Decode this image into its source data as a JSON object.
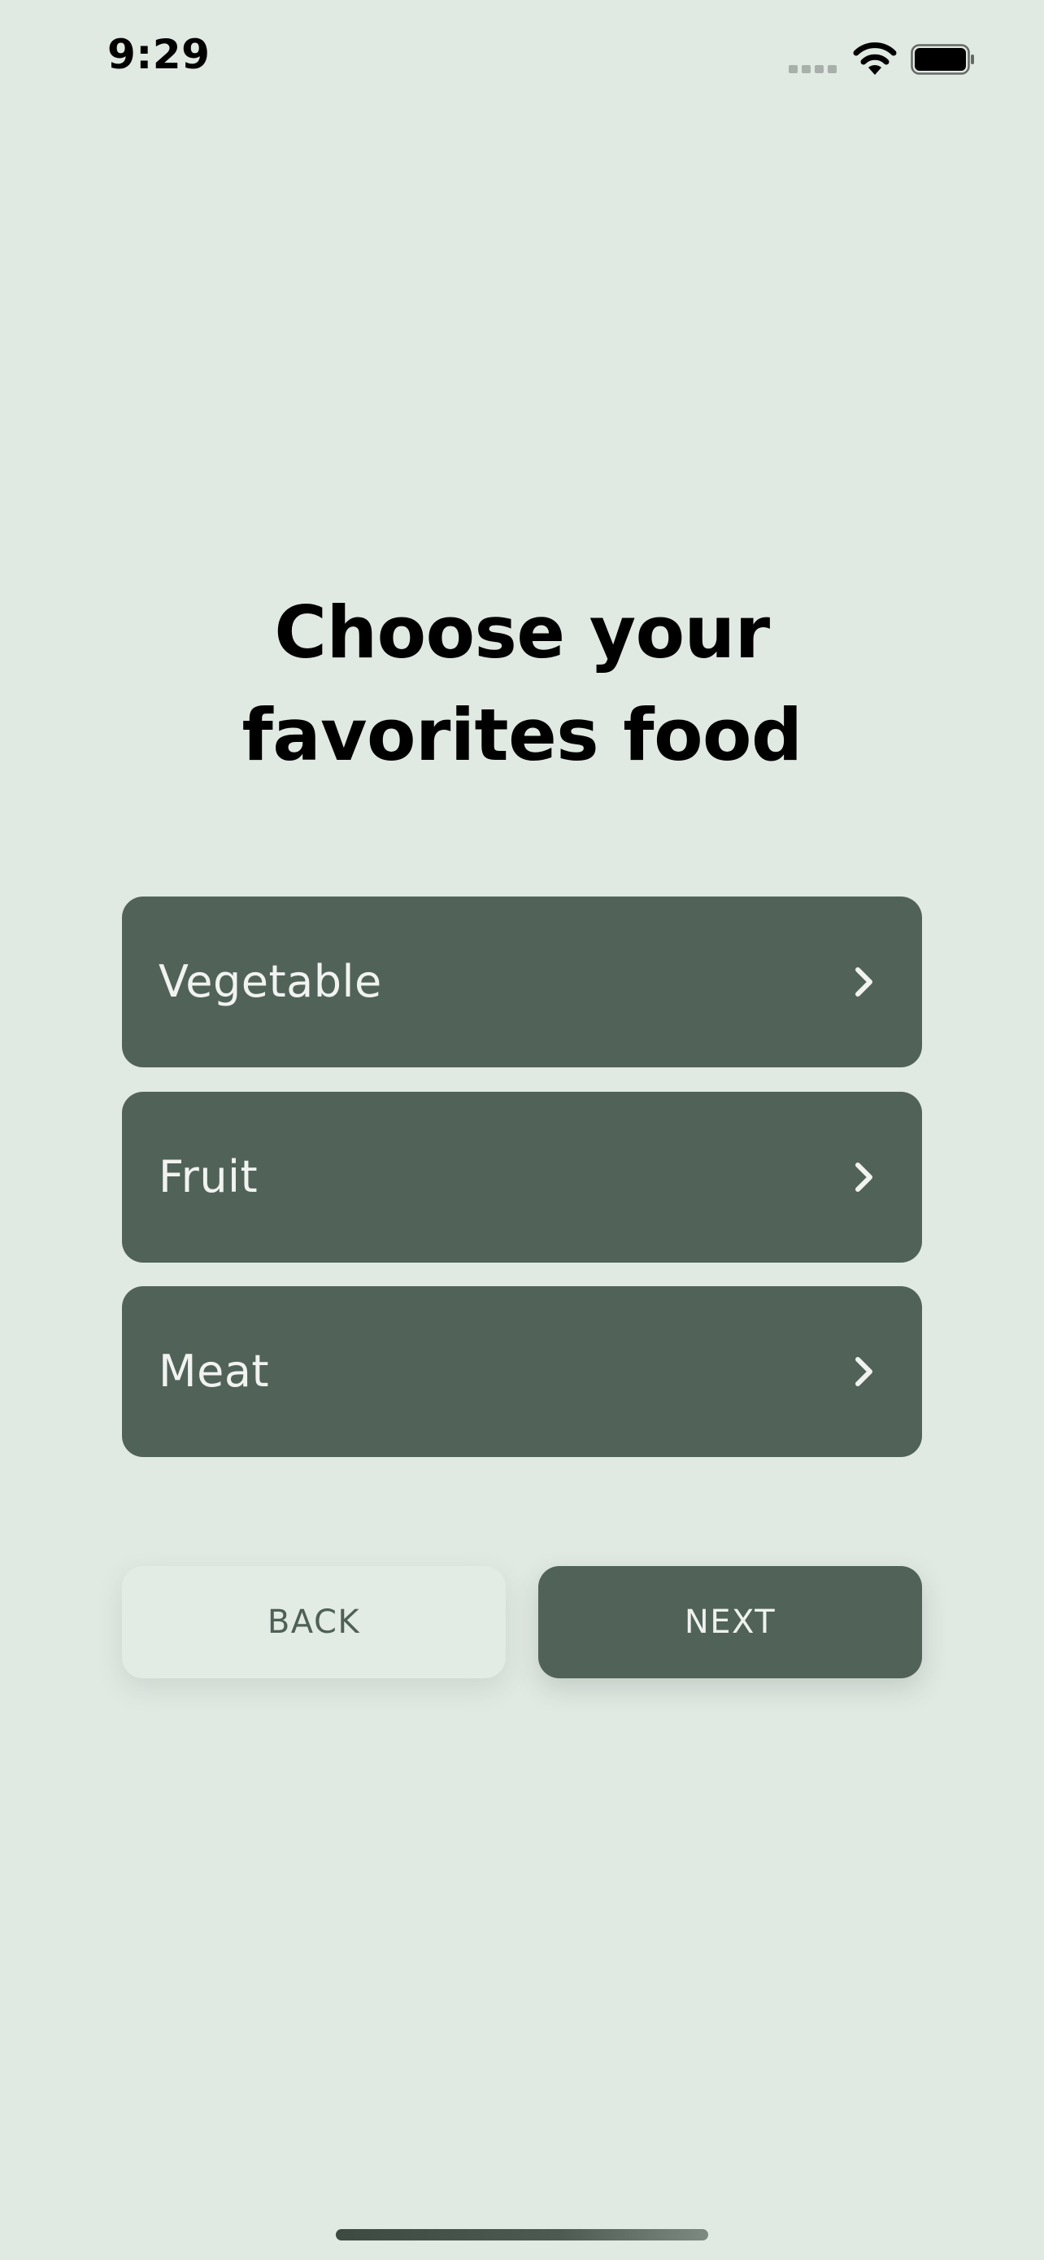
{
  "status_bar": {
    "time": "9:29"
  },
  "title": {
    "line1": "Choose your",
    "line2": "favorites food"
  },
  "options": [
    {
      "label": "Vegetable",
      "icon": "chevron-right-icon"
    },
    {
      "label": "Fruit",
      "icon": "chevron-right-icon"
    },
    {
      "label": "Meat",
      "icon": "chevron-right-icon"
    }
  ],
  "buttons": {
    "back_label": "BACK",
    "next_label": "NEXT"
  },
  "colors": {
    "background": "#e0e9e2",
    "primary": "#516358",
    "option_text": "#f1f3f1"
  }
}
